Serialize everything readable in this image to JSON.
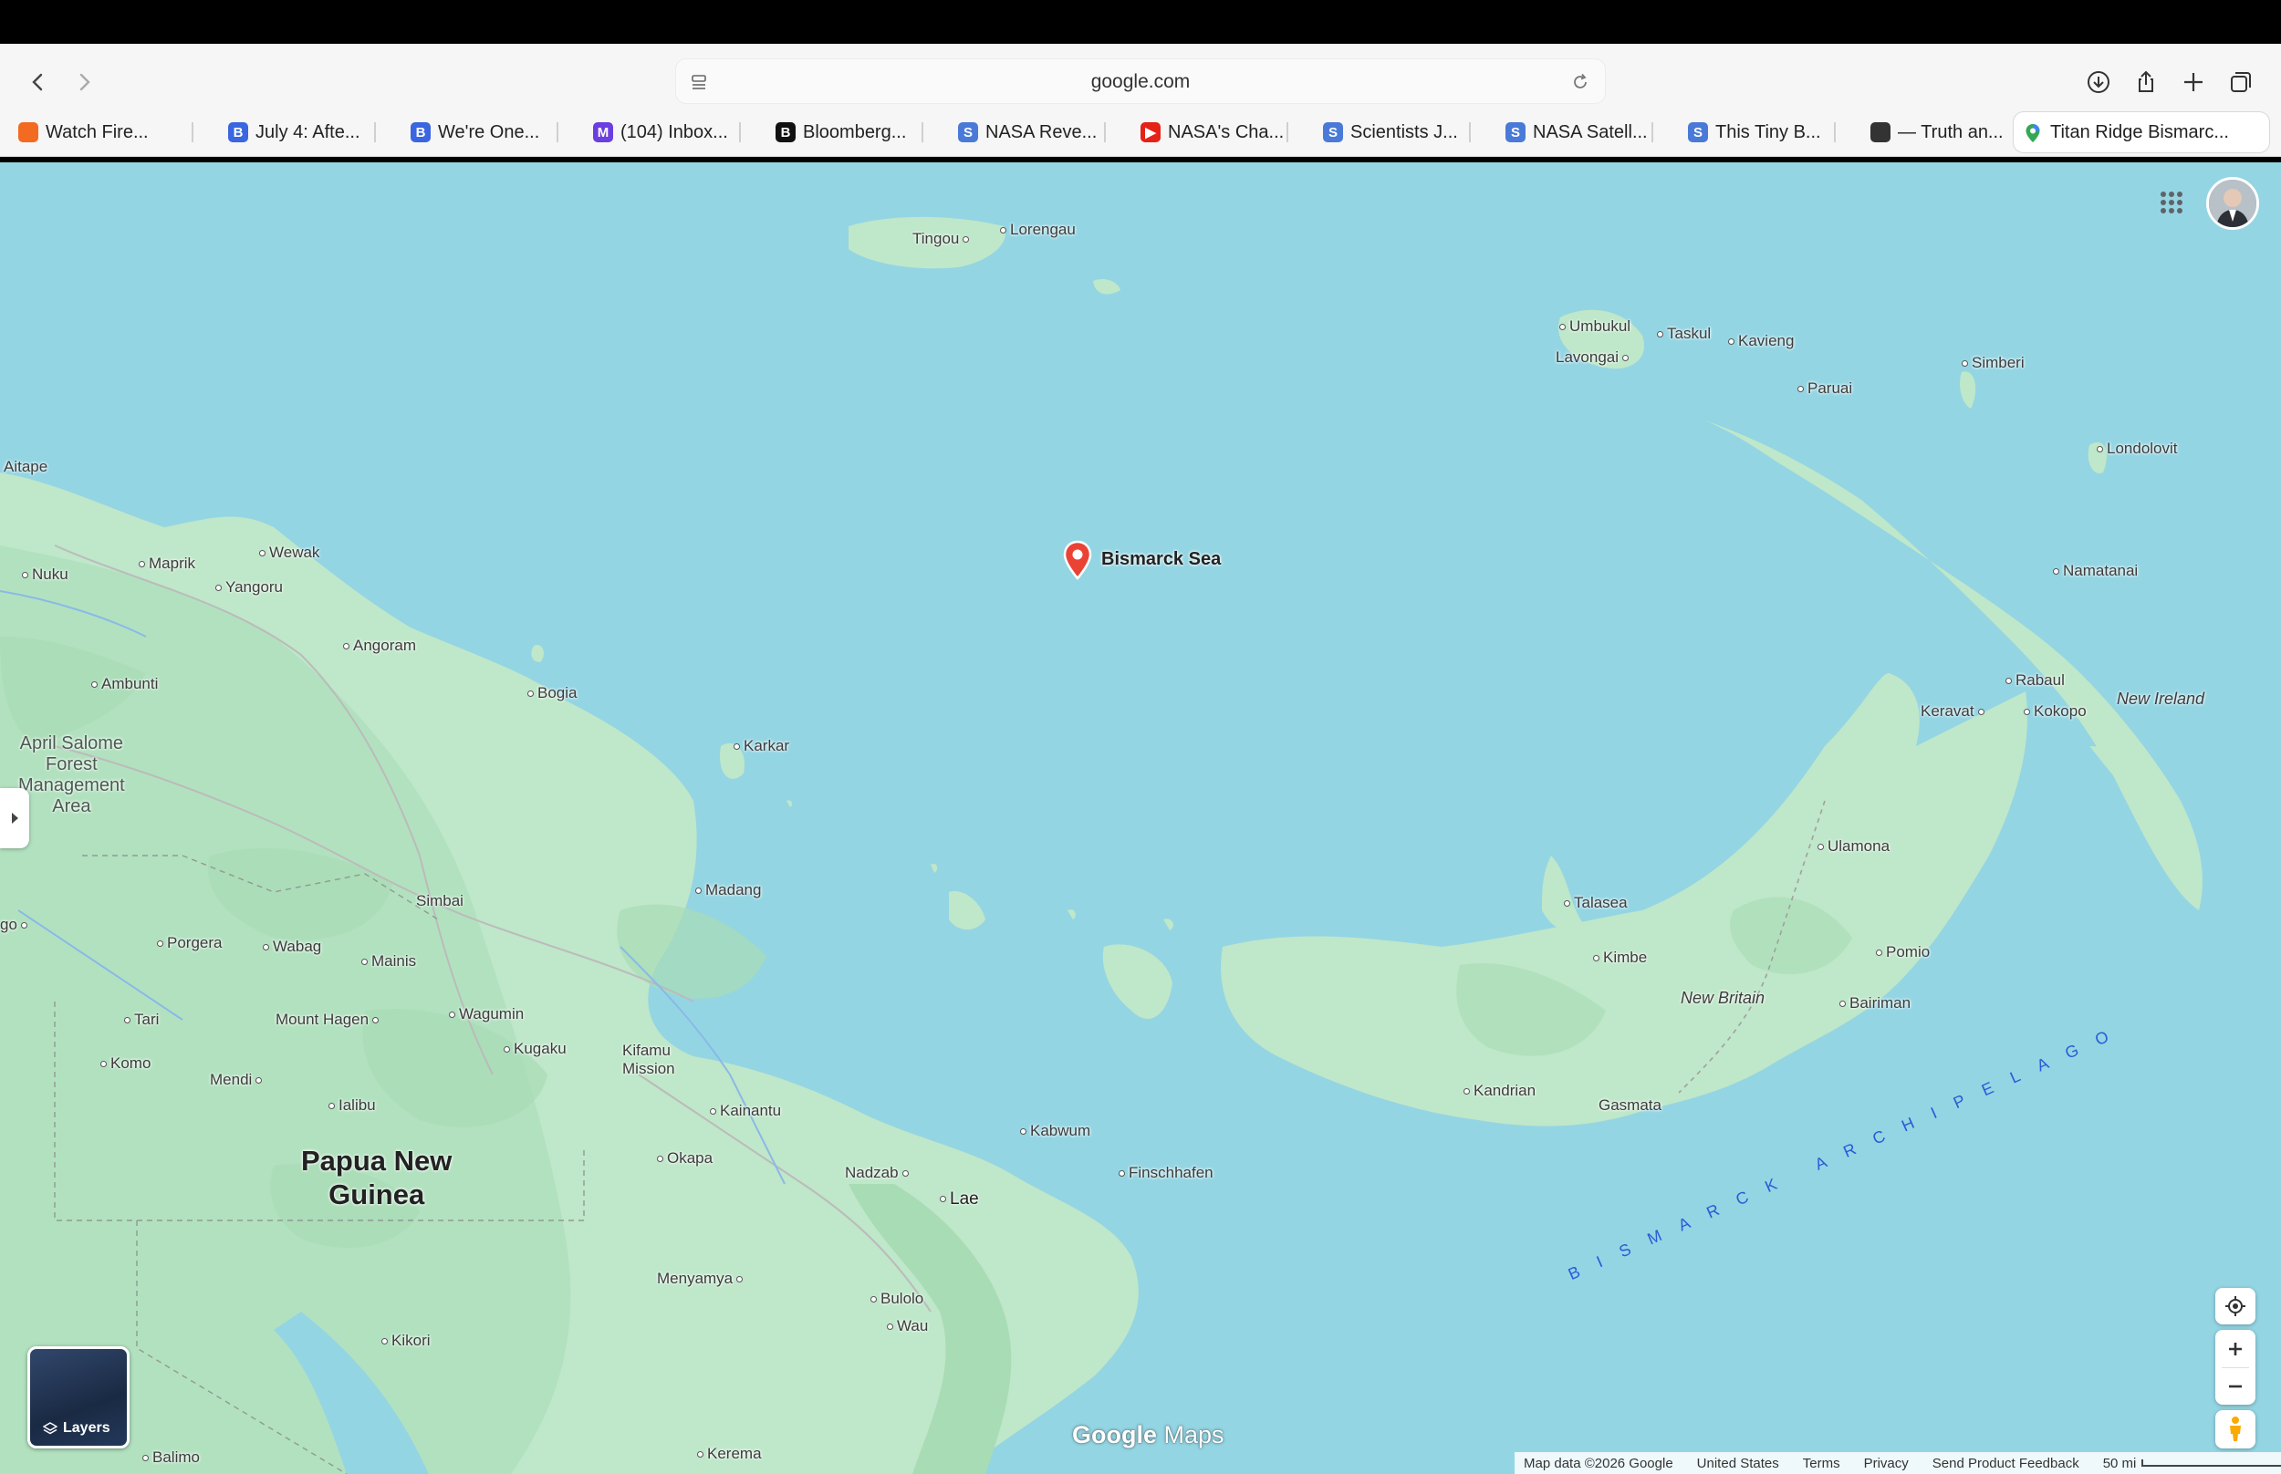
{
  "browser": {
    "url": "google.com",
    "tabs": [
      {
        "label": "Watch Fire...",
        "favicon": "orange-square-icon",
        "color": "#f26b21",
        "glyph": ""
      },
      {
        "label": "July 4: Afte...",
        "favicon": "b-circle-icon",
        "color": "#3a66e0",
        "glyph": "B"
      },
      {
        "label": "We're One...",
        "favicon": "b-circle-icon",
        "color": "#3a66e0",
        "glyph": "B"
      },
      {
        "label": "(104) Inbox...",
        "favicon": "mail-icon",
        "color": "#6a3ee0",
        "glyph": "M"
      },
      {
        "label": "Bloomberg...",
        "favicon": "b-black-icon",
        "color": "#111111",
        "glyph": "B"
      },
      {
        "label": "NASA Reve...",
        "favicon": "s-logo-icon",
        "color": "#4a7ad8",
        "glyph": "S"
      },
      {
        "label": "NASA's Cha...",
        "favicon": "youtube-icon",
        "color": "#e62117",
        "glyph": "▶"
      },
      {
        "label": "Scientists J...",
        "favicon": "s-logo-icon",
        "color": "#4a7ad8",
        "glyph": "S"
      },
      {
        "label": "NASA Satell...",
        "favicon": "s-logo-icon",
        "color": "#4a7ad8",
        "glyph": "S"
      },
      {
        "label": "This Tiny B...",
        "favicon": "s-logo-icon",
        "color": "#4a7ad8",
        "glyph": "S"
      },
      {
        "label": "— Truth an...",
        "favicon": "cube-icon",
        "color": "#333333",
        "glyph": ""
      },
      {
        "label": "Titan Ridge Bismarc...",
        "favicon": "maps-pin-icon",
        "color": "#34a853",
        "glyph": ""
      }
    ]
  },
  "map": {
    "pin_label": "Bismarck Sea",
    "country": "Papua New\nGuinea",
    "area": "April Salome\nForest\nManagement\nArea",
    "archipelago": "BISMARCK ARCHIPELAGO",
    "islands": {
      "new_ireland": "New Ireland",
      "new_britain": "New Britain"
    },
    "places": {
      "tingou": "Tingou",
      "lorengau": "Lorengau",
      "umbukul": "Umbukul",
      "taskul": "Taskul",
      "kavieng": "Kavieng",
      "lavongai": "Lavongai",
      "paruai": "Paruai",
      "simberi": "Simberi",
      "londolovit": "Londolovit",
      "aitape": "Aitape",
      "wewak": "Wewak",
      "maprik": "Maprik",
      "nuku": "Nuku",
      "yangoru": "Yangoru",
      "angoram": "Angoram",
      "ambunti": "Ambunti",
      "bogia": "Bogia",
      "karkar": "Karkar",
      "madang": "Madang",
      "namatanai": "Namatanai",
      "rabaul": "Rabaul",
      "keravat": "Keravat",
      "kokopo": "Kokopo",
      "ulamona": "Ulamona",
      "talasea": "Talasea",
      "kimbe": "Kimbe",
      "pomio": "Pomio",
      "bairiman": "Bairiman",
      "kandrian": "Kandrian",
      "gasmata": "Gasmata",
      "simbai": "Simbai",
      "porgera": "Porgera",
      "wabag": "Wabag",
      "mainis": "Mainis",
      "tari": "Tari",
      "mount_hagen": "Mount Hagen",
      "wagumin": "Wagumin",
      "kugaku": "Kugaku",
      "kifamu": "Kifamu\nMission",
      "komo": "Komo",
      "mendi": "Mendi",
      "ialibu": "Ialibu",
      "kainantu": "Kainantu",
      "kabwum": "Kabwum",
      "finschhafen": "Finschhafen",
      "okapa": "Okapa",
      "nadzab": "Nadzab",
      "lae": "Lae",
      "menyamya": "Menyamya",
      "bulolo": "Bulolo",
      "wau": "Wau",
      "kikori": "Kikori",
      "kerema": "Kerema",
      "balimo": "Balimo",
      "ego": "go"
    }
  },
  "controls": {
    "layers_label": "Layers",
    "logo_google": "Google",
    "logo_maps": "Maps"
  },
  "footer": {
    "map_data": "Map data ©2026 Google",
    "region": "United States",
    "terms": "Terms",
    "privacy": "Privacy",
    "feedback": "Send Product Feedback",
    "scale": "50 mi"
  },
  "colors": {
    "water": "#94d5e3",
    "land": "#bfe7c9",
    "land_dark": "#a8dcb5",
    "pin": "#ea4335",
    "archipelago": "#2a5bd8"
  }
}
